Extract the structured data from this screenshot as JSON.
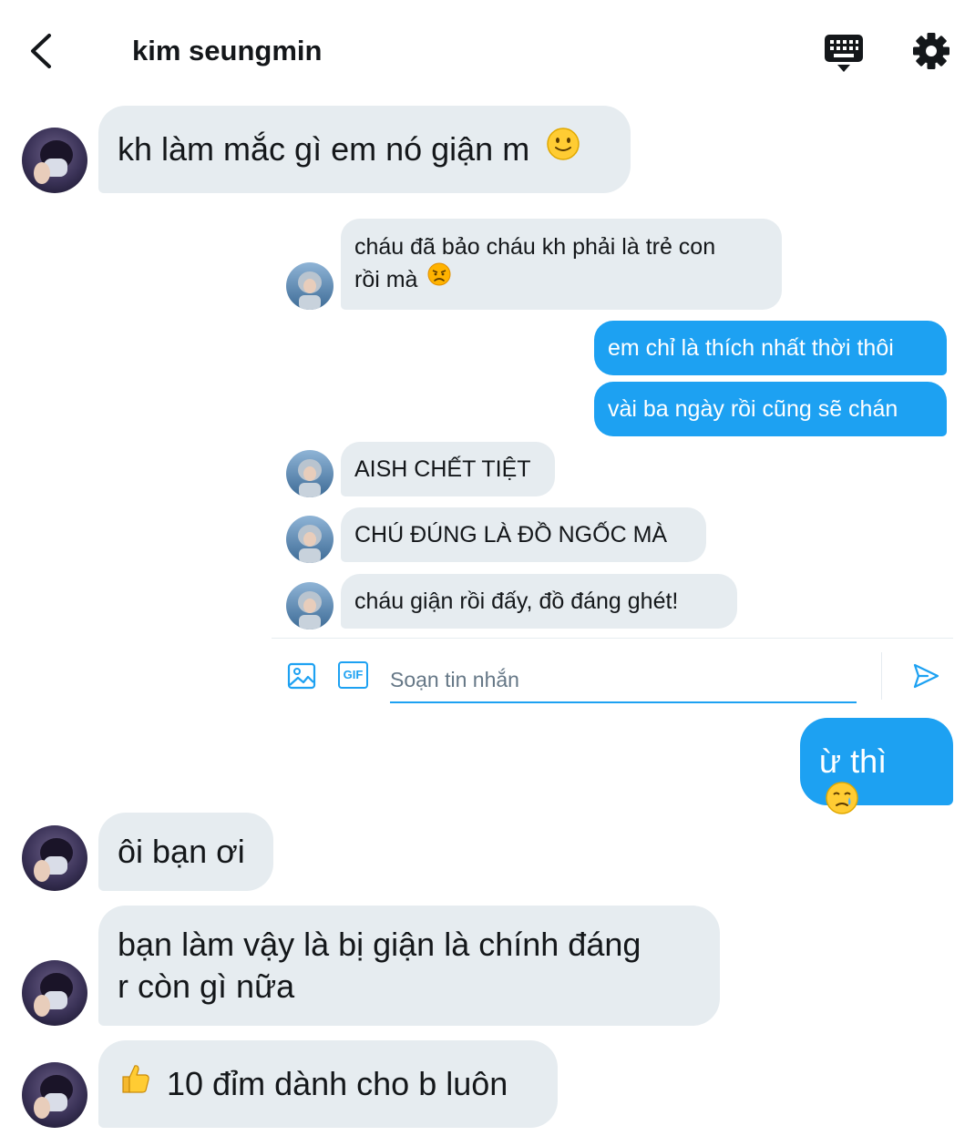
{
  "header": {
    "title": "kim seungmin"
  },
  "messages": [
    {
      "sender": "friend",
      "text": "kh làm mắc gì em nó giận m",
      "emoji": "slightly-smiling-face"
    },
    {
      "sender": "embedded-other",
      "line1": "cháu đã bảo cháu kh phải là trẻ con",
      "line2": "rồi mà",
      "emoji": "angry-face"
    },
    {
      "sender": "embedded-me",
      "text": "em chỉ là thích nhất thời thôi"
    },
    {
      "sender": "embedded-me",
      "text": "vài ba ngày rồi cũng sẽ chán"
    },
    {
      "sender": "embedded-other",
      "text": "AISH CHẾT TIỆT"
    },
    {
      "sender": "embedded-other",
      "text": "CHÚ ĐÚNG LÀ ĐỒ NGỐC MÀ"
    },
    {
      "sender": "embedded-other",
      "text": "cháu giận rồi đấy, đồ đáng ghét!"
    },
    {
      "sender": "me",
      "text": "ừ thì",
      "emoji": "crying-face"
    },
    {
      "sender": "friend",
      "text": "ôi bạn ơi"
    },
    {
      "sender": "friend",
      "line1": "bạn làm vậy là bị giận là chính đáng",
      "line2": "r còn gì nữa"
    },
    {
      "sender": "friend",
      "text": "10 đỉm dành cho b luôn",
      "emoji": "thumbs-up"
    }
  ],
  "composer": {
    "placeholder": "Soạn tin nhắn",
    "icons": [
      "image-icon",
      "gif-icon",
      "send-icon"
    ],
    "gif_label": "GIF"
  },
  "colors": {
    "accent": "#1da1f2",
    "incoming_bubble": "#e6ecf0",
    "text": "#14171a",
    "placeholder": "#657786"
  }
}
